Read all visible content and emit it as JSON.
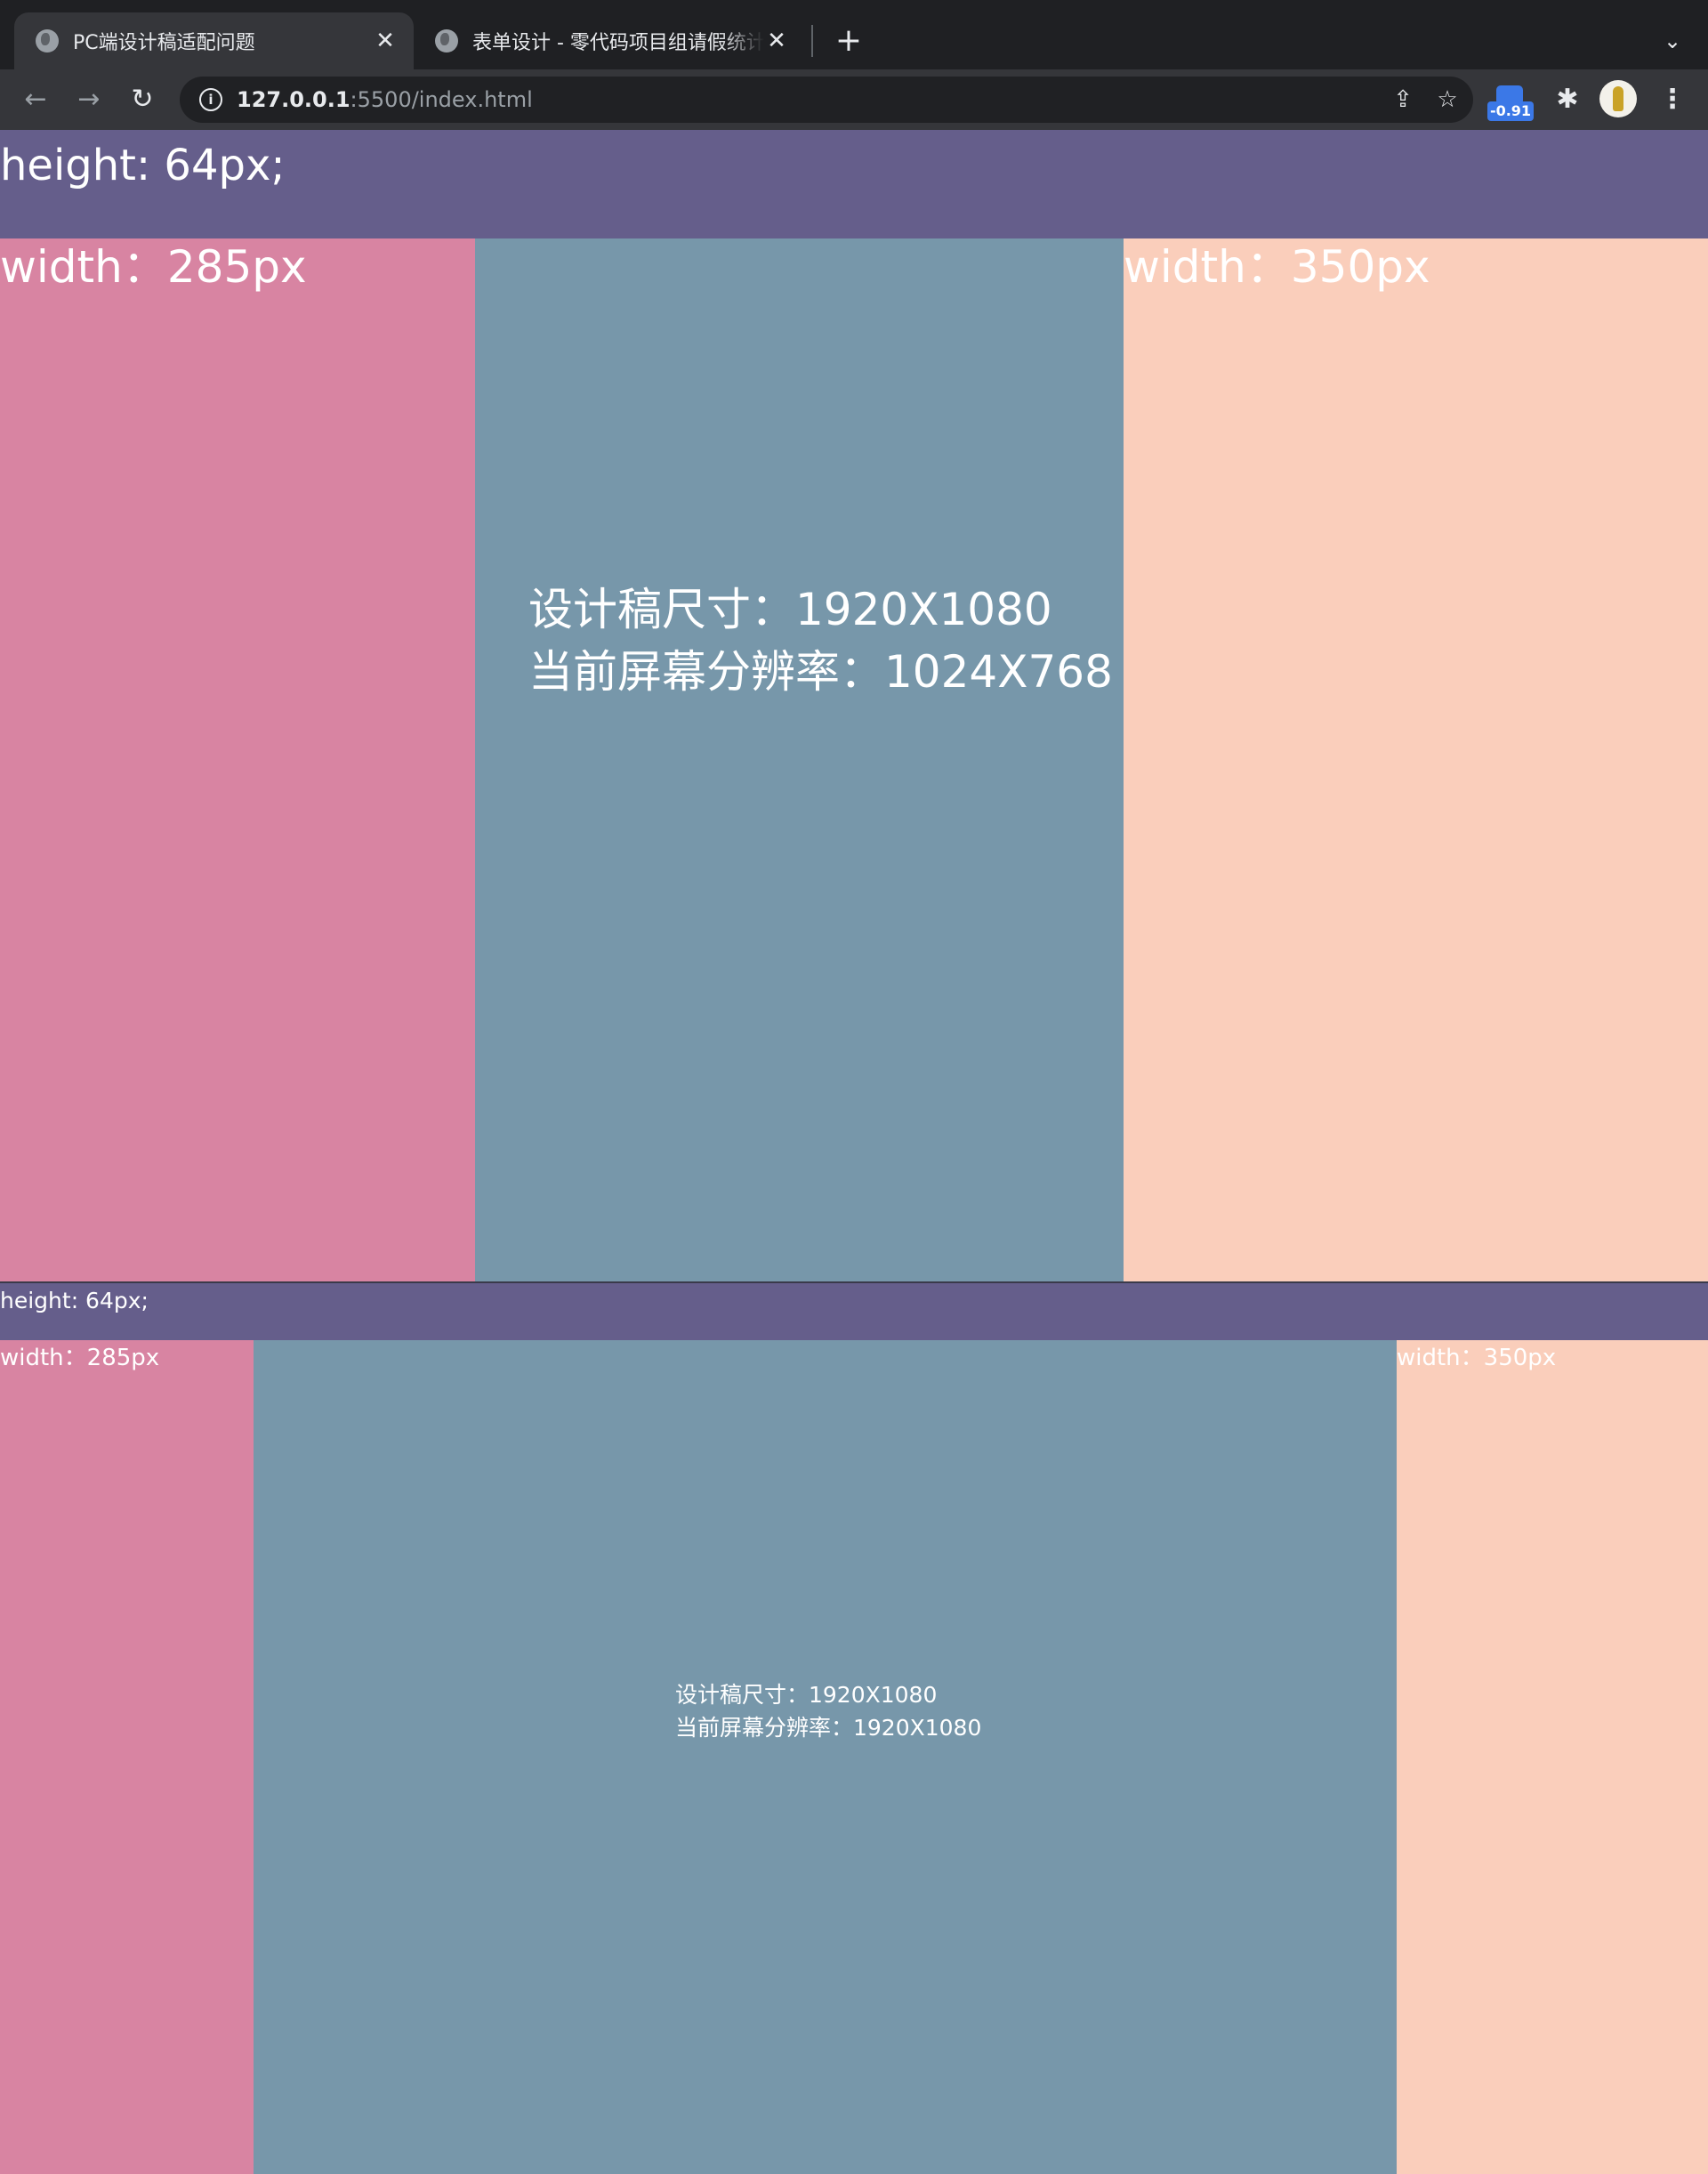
{
  "browser": {
    "tabs": [
      {
        "title": "PC端设计稿适配问题",
        "active": true,
        "favicon": "globe-icon"
      },
      {
        "title": "表单设计 - 零代码项目组请假统计",
        "active": false,
        "favicon": "globe-icon"
      }
    ],
    "close_glyph": "✕",
    "new_tab_glyph": "+",
    "tab_list_glyph": "⌄",
    "url_host": "127.0.0.1",
    "url_rest": ":5500/index.html",
    "extension_badge": "-0.91"
  },
  "section_large": {
    "header_label": "height: 64px;",
    "left_label": "width：285px",
    "right_label": "width：350px",
    "design_size": "设计稿尺寸：1920X1080",
    "screen_resolution": "当前屏幕分辨率：1024X768"
  },
  "section_native": {
    "header_label": "height: 64px;",
    "left_label": "width：285px",
    "right_label": "width：350px",
    "design_size": "设计稿尺寸：1920X1080",
    "screen_resolution": "当前屏幕分辨率：1920X1080"
  },
  "colors": {
    "header": "#655e8b",
    "left_aside": "#d884a2",
    "main": "#7797aa",
    "right_aside": "#facebb",
    "chrome_dark": "#1f2023",
    "chrome_toolbar": "#35363a"
  }
}
